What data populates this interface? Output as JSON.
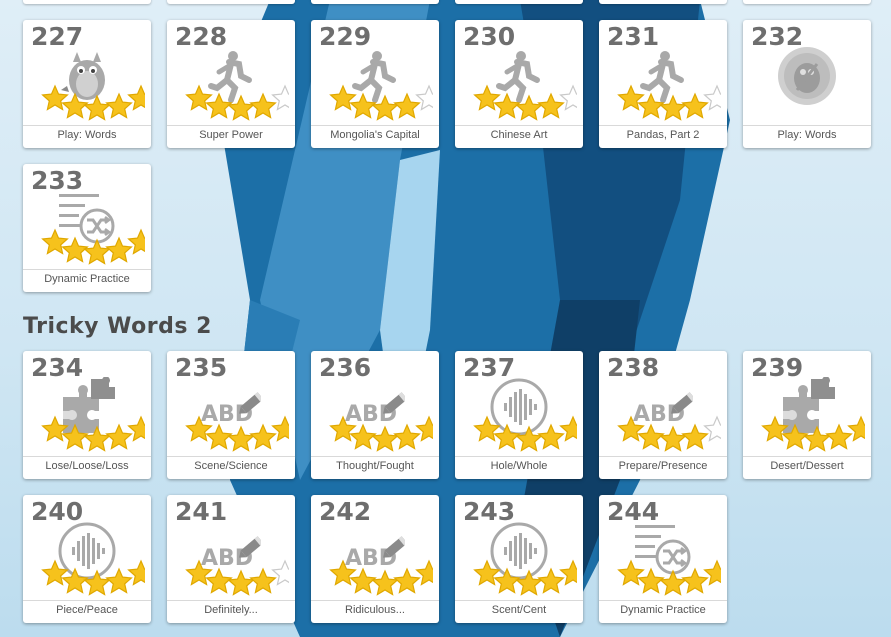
{
  "section": {
    "title": "Tricky Words 2"
  },
  "cards": [
    {
      "num": "227",
      "label": "Play: Words",
      "icon": "mascot-dragon-icon",
      "stars": 5
    },
    {
      "num": "228",
      "label": "Super Power",
      "icon": "runner-icon",
      "stars": 4
    },
    {
      "num": "229",
      "label": "Mongolia's Capital",
      "icon": "runner-icon",
      "stars": 4
    },
    {
      "num": "230",
      "label": "Chinese Art",
      "icon": "runner-icon",
      "stars": 4
    },
    {
      "num": "231",
      "label": "Pandas, Part 2",
      "icon": "runner-icon",
      "stars": 4
    },
    {
      "num": "232",
      "label": "Play: Words",
      "icon": "locked-mascot-icon",
      "stars": 0
    },
    {
      "num": "233",
      "label": "Dynamic Practice",
      "icon": "shuffle-list-icon",
      "stars": 5
    },
    {
      "num": "234",
      "label": "Lose/Loose/Loss",
      "icon": "puzzle-icon",
      "stars": 5
    },
    {
      "num": "235",
      "label": "Scene/Science",
      "icon": "abc-spelling-icon",
      "stars": 5
    },
    {
      "num": "236",
      "label": "Thought/Fought",
      "icon": "abc-spelling-icon",
      "stars": 5
    },
    {
      "num": "237",
      "label": "Hole/Whole",
      "icon": "audio-wave-icon",
      "stars": 5
    },
    {
      "num": "238",
      "label": "Prepare/Presence",
      "icon": "abc-spelling-icon",
      "stars": 4
    },
    {
      "num": "239",
      "label": "Desert/Dessert",
      "icon": "puzzle-icon",
      "stars": 5
    },
    {
      "num": "240",
      "label": "Piece/Peace",
      "icon": "audio-wave-icon",
      "stars": 5
    },
    {
      "num": "241",
      "label": "Definitely...",
      "icon": "abc-spelling-icon",
      "stars": 4
    },
    {
      "num": "242",
      "label": "Ridiculous...",
      "icon": "abc-spelling-icon",
      "stars": 5
    },
    {
      "num": "243",
      "label": "Scent/Cent",
      "icon": "audio-wave-icon",
      "stars": 5
    },
    {
      "num": "244",
      "label": "Dynamic Practice",
      "icon": "shuffle-list-icon",
      "stars": 5
    }
  ],
  "colors": {
    "star_fill": "#f6c21c",
    "star_empty": "#ffffff",
    "icon_gray": "#a9a9a9"
  }
}
